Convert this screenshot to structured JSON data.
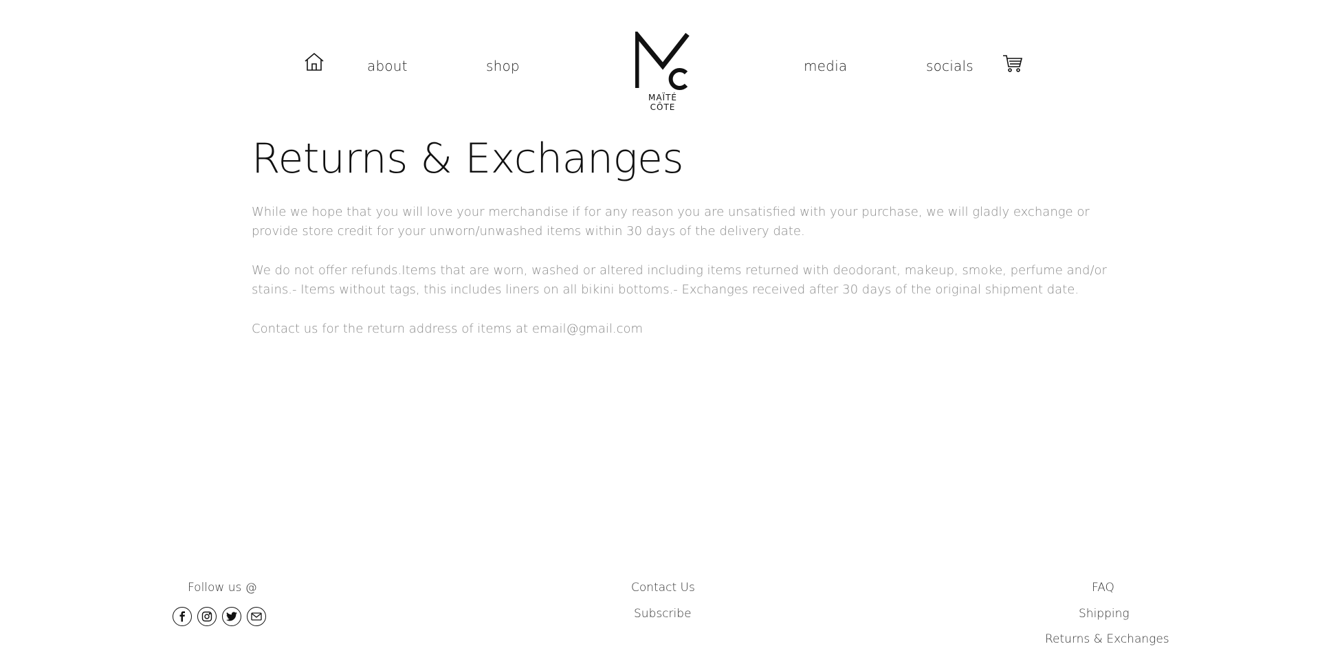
{
  "header": {
    "nav_left": [
      {
        "label": "about"
      },
      {
        "label": "shop"
      }
    ],
    "nav_right": [
      {
        "label": "media"
      },
      {
        "label": "socials"
      }
    ],
    "logo": {
      "text": "MAÏTÉ CÔTE",
      "letters": "Mc"
    },
    "icons": {
      "home": "home-icon",
      "cart": "cart-icon"
    }
  },
  "main": {
    "title": "Returns & Exchanges",
    "paragraphs": [
      "While we hope that you will love your merchandise if for any reason you are unsatisfied with your purchase, we will gladly exchange or provide store credit for your unworn/unwashed items within 30 days of the delivery date.",
      "We do not offer refunds.Items that are worn, washed or altered including items returned with deodorant, makeup, smoke, perfume and/or stains.- Items without tags, this includes liners on all bikini bottoms.- Exchanges received after 30 days of the original shipment date.",
      "Contact us for the return address of items at email@gmail.com"
    ]
  },
  "footer": {
    "follow_label": "Follow us @",
    "social_icons": [
      "facebook-icon",
      "instagram-icon",
      "twitter-icon",
      "email-icon"
    ],
    "center_links": [
      {
        "label": "Contact Us"
      },
      {
        "label": "Subscribe"
      }
    ],
    "right_links": [
      {
        "label": "FAQ"
      },
      {
        "label": "Shipping"
      },
      {
        "label": "Returns & Exchanges"
      }
    ]
  },
  "colors": {
    "text_dark": "#111111",
    "text_body": "#8a8a8a",
    "background": "#ffffff"
  }
}
